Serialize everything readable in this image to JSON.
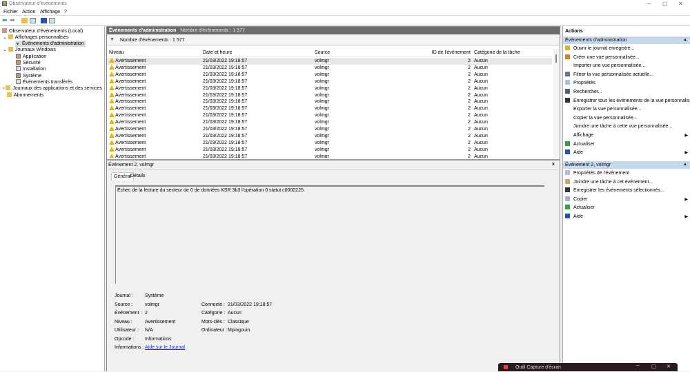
{
  "window": {
    "title": "Observateur d'événements"
  },
  "menu": [
    "Fichier",
    "Action",
    "Affichage",
    "?"
  ],
  "tree": {
    "root": "Observateur d'événements (Local)",
    "custom_views": "Affichages personnalisés",
    "admin_events": "Événements d'administration",
    "windows_logs": "Journaux Windows",
    "logs": [
      "Application",
      "Sécurité",
      "Installation",
      "Système",
      "Événements transférés"
    ],
    "app_logs": "Journaux des applications et des services",
    "subscriptions": "Abonnements"
  },
  "center": {
    "title": "Événements d'administration",
    "count_label": "Nombre d'événements : 1 577",
    "filter_label": "Nombre d'événements : 1 577",
    "columns": [
      "Niveau",
      "Date et heure",
      "Source",
      "ID de l'événement",
      "Catégorie de la tâche"
    ],
    "rows": [
      {
        "level": "Avertissement",
        "date": "21/03/2022 19:18:57",
        "source": "volmgr",
        "id": "2",
        "category": "Aucun"
      },
      {
        "level": "Avertissement",
        "date": "21/03/2022 19:18:57",
        "source": "volmgr",
        "id": "2",
        "category": "Aucun"
      },
      {
        "level": "Avertissement",
        "date": "21/03/2022 19:18:57",
        "source": "volmgr",
        "id": "2",
        "category": "Aucun"
      },
      {
        "level": "Avertissement",
        "date": "21/03/2022 19:18:57",
        "source": "volmgr",
        "id": "2",
        "category": "Aucun"
      },
      {
        "level": "Avertissement",
        "date": "21/03/2022 19:18:57",
        "source": "volmgr",
        "id": "2",
        "category": "Aucun"
      },
      {
        "level": "Avertissement",
        "date": "21/03/2022 19:18:57",
        "source": "volmgr",
        "id": "2",
        "category": "Aucun"
      },
      {
        "level": "Avertissement",
        "date": "21/03/2022 19:18:57",
        "source": "volmgr",
        "id": "2",
        "category": "Aucun"
      },
      {
        "level": "Avertissement",
        "date": "21/03/2022 19:18:57",
        "source": "volmgr",
        "id": "2",
        "category": "Aucun"
      },
      {
        "level": "Avertissement",
        "date": "21/03/2022 19:18:57",
        "source": "volmgr",
        "id": "2",
        "category": "Aucun"
      },
      {
        "level": "Avertissement",
        "date": "21/03/2022 19:18:57",
        "source": "volmgr",
        "id": "2",
        "category": "Aucun"
      },
      {
        "level": "Avertissement",
        "date": "21/03/2022 19:18:57",
        "source": "volmgr",
        "id": "2",
        "category": "Aucun"
      },
      {
        "level": "Avertissement",
        "date": "21/03/2022 19:18:57",
        "source": "volmgr",
        "id": "2",
        "category": "Aucun"
      },
      {
        "level": "Avertissement",
        "date": "21/03/2022 19:18:57",
        "source": "volmgr",
        "id": "2",
        "category": "Aucun"
      },
      {
        "level": "Avertissement",
        "date": "21/03/2022 19:18:57",
        "source": "volmgr",
        "id": "2",
        "category": "Aucun"
      },
      {
        "level": "Avertissement",
        "date": "21/03/2022 19:18:57",
        "source": "volmgr",
        "id": "2",
        "category": "Aucun"
      }
    ]
  },
  "detail": {
    "title": "Événement 2, volmgr",
    "close": "x",
    "tabs": [
      "Général",
      "Détails"
    ],
    "message": "Échec de la lecture du secteur de 0 de données KSR 3b3 l'opération 0 statut c0000225.",
    "fields_left": [
      {
        "label": "Journal :",
        "value": "Système"
      },
      {
        "label": "Source :",
        "value": "volmgr"
      },
      {
        "label": "Événement :",
        "value": "2"
      },
      {
        "label": "Niveau :",
        "value": "Avertissement"
      },
      {
        "label": "Utilisateur :",
        "value": "N/A"
      },
      {
        "label": "Opcode :",
        "value": "Informations"
      },
      {
        "label": "Informations :",
        "value": "Aide sur le Journal"
      }
    ],
    "fields_right": [
      {
        "label": "Connecté :",
        "value": "21/03/2022 19:18:57"
      },
      {
        "label": "Catégorie :",
        "value": "Aucun"
      },
      {
        "label": "Mots-clés :",
        "value": "Classique"
      },
      {
        "label": "Ordinateur :",
        "value": "Mpingouin"
      }
    ]
  },
  "actions": {
    "title": "Actions",
    "section1": "Événements d'administration",
    "items1": [
      {
        "label": "Ouvrir le journal enregistré...",
        "icon": "folder-icon",
        "color": "#e0b030"
      },
      {
        "label": "Créer une vue personnalisée...",
        "icon": "filter-icon",
        "color": "#d08020"
      },
      {
        "label": "Importer une vue personnalisée...",
        "icon": "",
        "color": ""
      },
      {
        "label": "Filtrer la vue personnalisée actuelle...",
        "icon": "filter-icon",
        "color": "#607890"
      },
      {
        "label": "Propriétés",
        "icon": "properties-icon",
        "color": "#b0c0d0"
      },
      {
        "label": "Rechercher...",
        "icon": "binoculars-icon",
        "color": "#506070"
      },
      {
        "label": "Enregistrer tous les événements de la vue personnalisé...",
        "icon": "save-icon",
        "color": "#333"
      },
      {
        "label": "Exporter la vue personnalisée...",
        "icon": "",
        "color": ""
      },
      {
        "label": "Copier la vue personnalisée...",
        "icon": "",
        "color": ""
      },
      {
        "label": "Joindre une tâche à cette vue personnalisée...",
        "icon": "",
        "color": ""
      },
      {
        "label": "Affichage",
        "icon": "",
        "color": "",
        "sub": true
      },
      {
        "label": "Actualiser",
        "icon": "refresh-icon",
        "color": "#30a040"
      },
      {
        "label": "Aide",
        "icon": "help-icon",
        "color": "#2050b0",
        "sub": true
      }
    ],
    "section2": "Événement 2, volmgr",
    "items2": [
      {
        "label": "Propriétés de l'événement",
        "icon": "properties-icon",
        "color": "#b0c0d0"
      },
      {
        "label": "Joindre une tâche à cet événement...",
        "icon": "task-icon",
        "color": "#d0a060"
      },
      {
        "label": "Enregistrer les événements sélectionnés...",
        "icon": "save-icon",
        "color": "#333"
      },
      {
        "label": "Copier",
        "icon": "copy-icon",
        "color": "#a0b0c0",
        "sub": true
      },
      {
        "label": "Actualiser",
        "icon": "refresh-icon",
        "color": "#30a040"
      },
      {
        "label": "Aide",
        "icon": "help-icon",
        "color": "#2050b0",
        "sub": true
      }
    ]
  },
  "taskbar": {
    "label": "Outil Capture d'écran"
  }
}
